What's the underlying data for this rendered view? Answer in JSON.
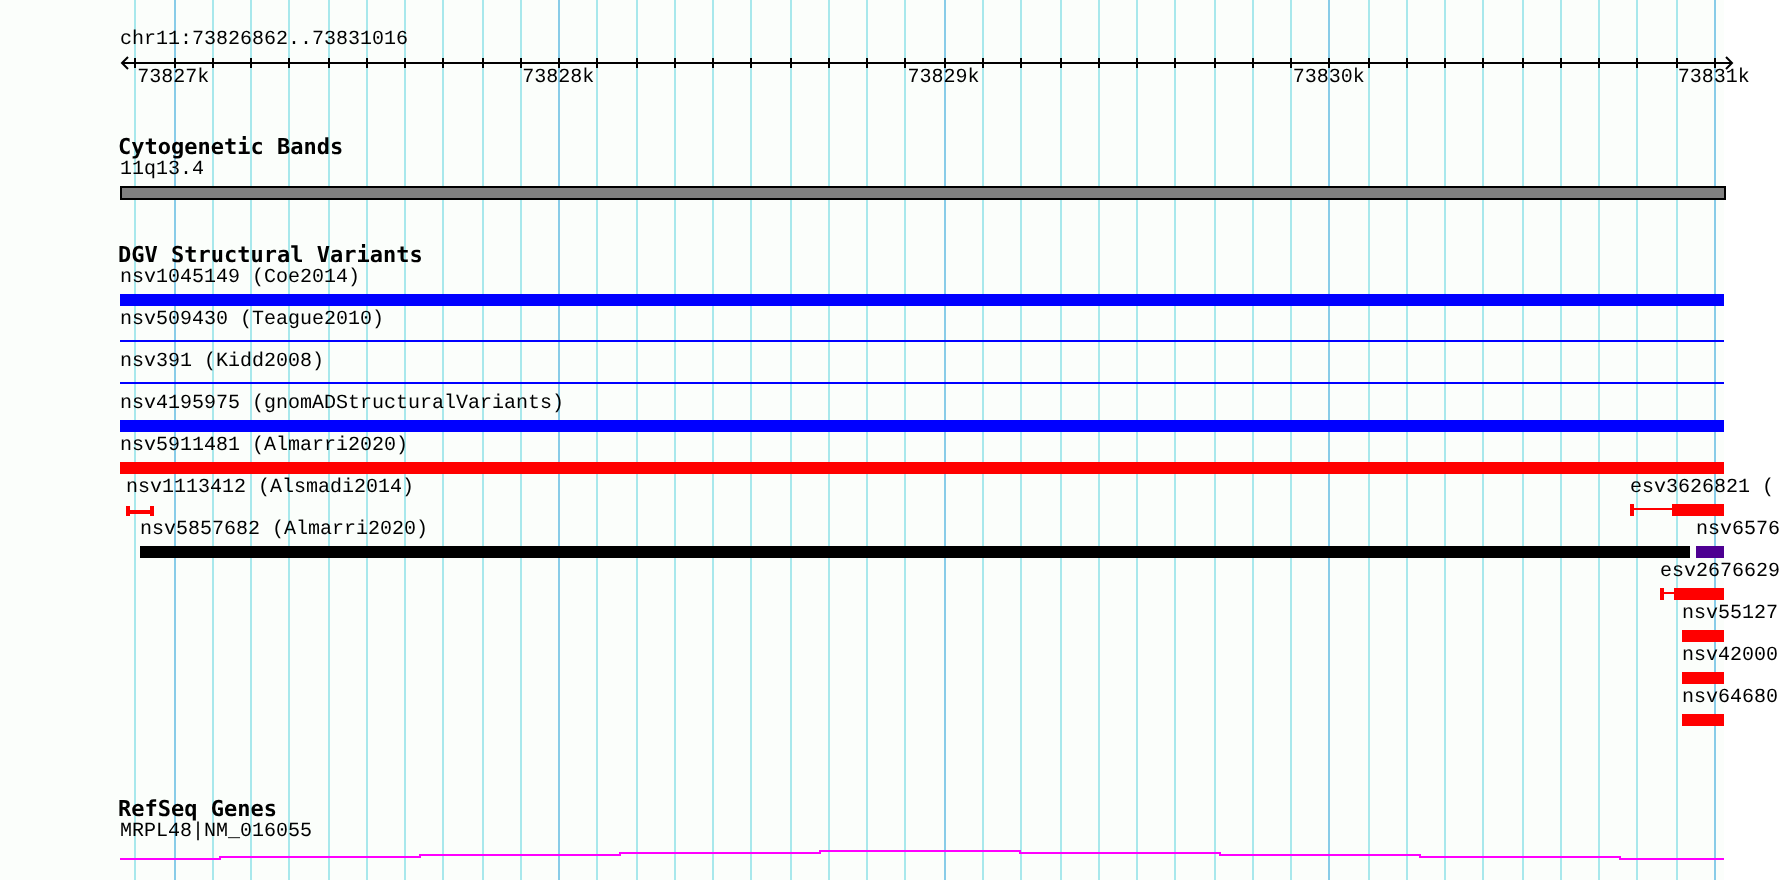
{
  "ruler": {
    "location": "chr11:73826862..73831016",
    "ticks": [
      {
        "label": "73827k"
      },
      {
        "label": "73828k"
      },
      {
        "label": "73829k"
      },
      {
        "label": "73830k"
      },
      {
        "label": "73831k"
      }
    ]
  },
  "cytoband_track": {
    "title": "Cytogenetic Bands",
    "band": {
      "name": "11q13.4"
    }
  },
  "dgv_track": {
    "title": "DGV Structural Variants",
    "rows": [
      {
        "features": [
          {
            "label": "nsv1045149 (Coe2014)",
            "kind": "thick",
            "color": "#0000ff"
          }
        ]
      },
      {
        "features": [
          {
            "label": "nsv509430 (Teague2010)",
            "kind": "thin",
            "color": "#0000ff"
          }
        ]
      },
      {
        "features": [
          {
            "label": "nsv391 (Kidd2008)",
            "kind": "thin",
            "color": "#0000ff"
          }
        ]
      },
      {
        "features": [
          {
            "label": "nsv4195975 (gnomADStructuralVariants)",
            "kind": "thick",
            "color": "#0000ff"
          }
        ]
      },
      {
        "features": [
          {
            "label": "nsv5911481 (Almarri2020)",
            "kind": "thick",
            "color": "#ff0000"
          }
        ]
      },
      {
        "features": [
          {
            "label": "nsv1113412 (Alsmadi2014)",
            "kind": "whisker",
            "color": "#ff0000"
          },
          {
            "label": "esv3626821 (",
            "kind": "capped",
            "color": "#ff0000"
          }
        ]
      },
      {
        "features": [
          {
            "label": "nsv5857682 (Almarri2020)",
            "kind": "thick",
            "color": "#000000"
          },
          {
            "label": "nsv6576",
            "kind": "thick",
            "color": "#4c0091"
          }
        ]
      },
      {
        "features": [
          {
            "label": "esv2676629",
            "kind": "capped",
            "color": "#ff0000"
          }
        ]
      },
      {
        "features": [
          {
            "label": "nsv55127",
            "kind": "thick",
            "color": "#ff0000"
          }
        ]
      },
      {
        "features": [
          {
            "label": "nsv42000",
            "kind": "thick",
            "color": "#ff0000"
          }
        ]
      },
      {
        "features": [
          {
            "label": "nsv64680",
            "kind": "thick",
            "color": "#ff0000"
          }
        ]
      }
    ]
  },
  "refseq_track": {
    "title": "RefSeq Genes",
    "gene": {
      "label": "MRPL48|NM_016055"
    }
  }
}
